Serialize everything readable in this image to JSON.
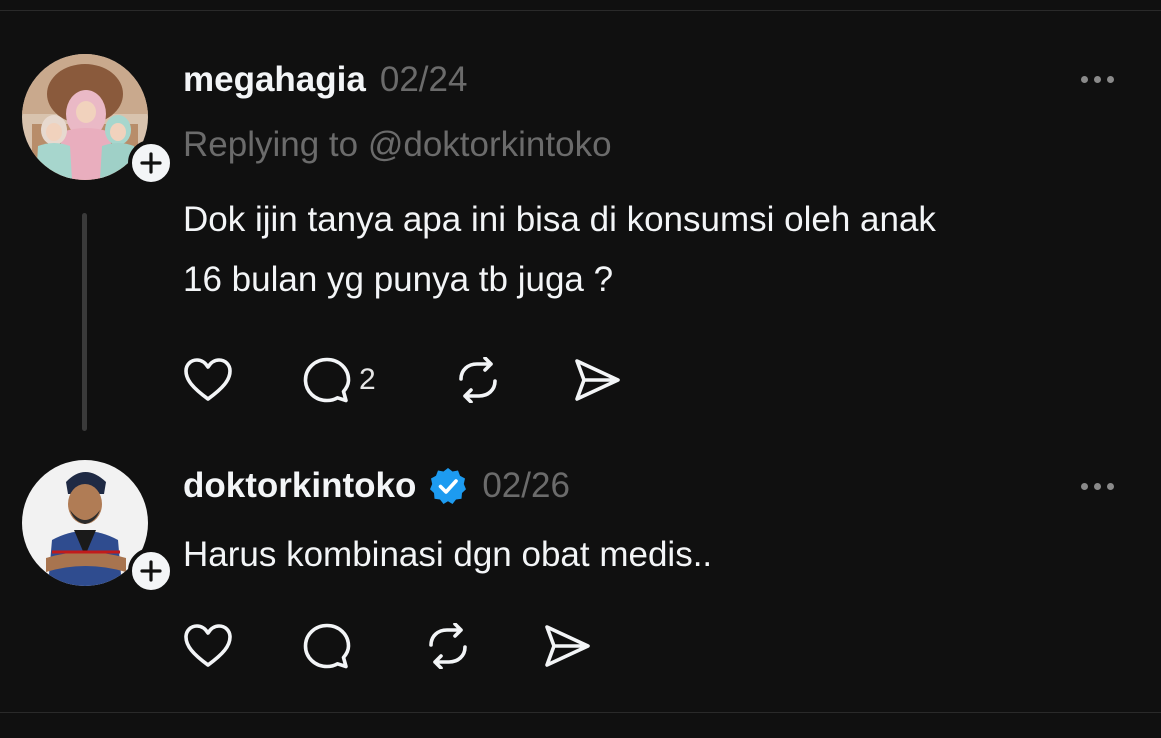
{
  "posts": [
    {
      "username": "megahagia",
      "date": "02/24",
      "replying_to": "Replying to @doktorkintoko",
      "text_lines": [
        "Dok ijin tanya apa ini bisa di konsumsi oleh anak",
        "16 bulan yg punya tb juga ?"
      ],
      "reply_count": "2",
      "verified": false
    },
    {
      "username": "doktorkintoko",
      "date": "02/26",
      "text": "Harus kombinasi dgn obat medis..",
      "verified": true
    }
  ],
  "colors": {
    "background": "#101010",
    "text_primary": "#f3f5f7",
    "text_secondary": "#6b6b6b",
    "verified_blue": "#1d9bf0"
  },
  "icons": [
    "heart-icon",
    "comment-icon",
    "repost-icon",
    "share-icon",
    "more-icon",
    "plus-icon",
    "verified-icon"
  ]
}
